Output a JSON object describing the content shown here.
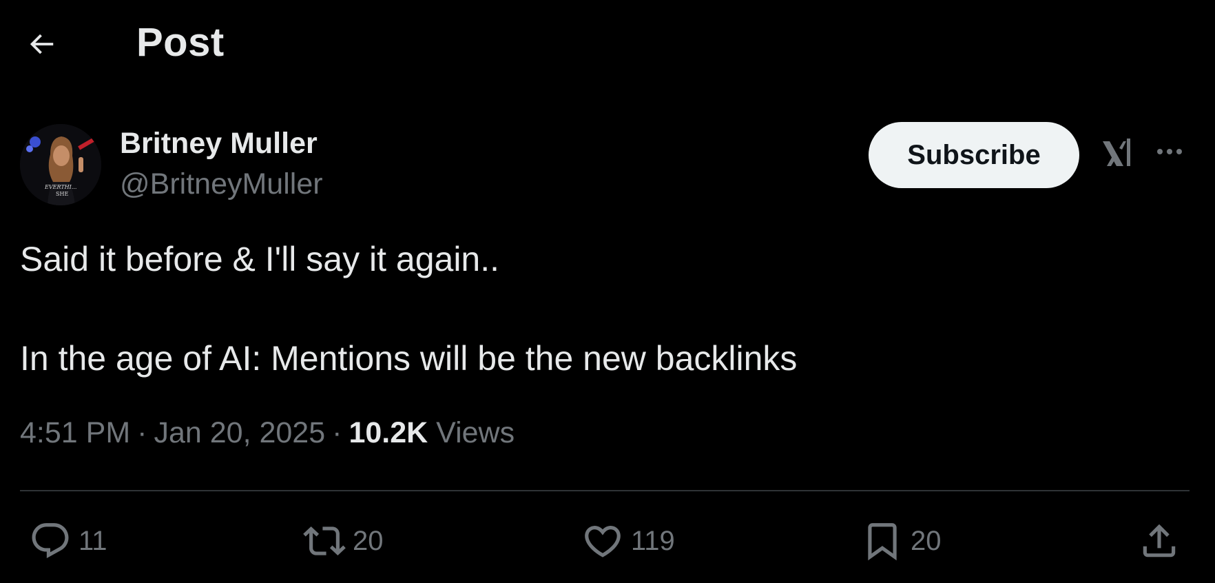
{
  "header": {
    "title": "Post",
    "back_icon": "arrow-left-icon"
  },
  "author": {
    "name": "Britney Muller",
    "handle": "@BritneyMuller",
    "avatar_shirt_text_1": "EVERTHI...",
    "avatar_shirt_text_2": "SHE"
  },
  "actions_top": {
    "subscribe_label": "Subscribe",
    "grok_icon": "grok-icon",
    "more_icon": "more-horizontal-icon"
  },
  "post": {
    "line1": "Said it before & I'll say it again..",
    "line2": "In the age of AI: Mentions will be the new backlinks",
    "time": "4:51 PM",
    "date": "Jan 20, 2025",
    "views_count": "10.2K",
    "views_label": "Views"
  },
  "engagement": {
    "replies": "11",
    "reposts": "20",
    "likes": "119",
    "bookmarks": "20"
  },
  "colors": {
    "background": "#000000",
    "primary_text": "#e7e9ea",
    "secondary_text": "#71767b",
    "divider": "#2f3336",
    "subscribe_bg": "#eff3f4"
  }
}
